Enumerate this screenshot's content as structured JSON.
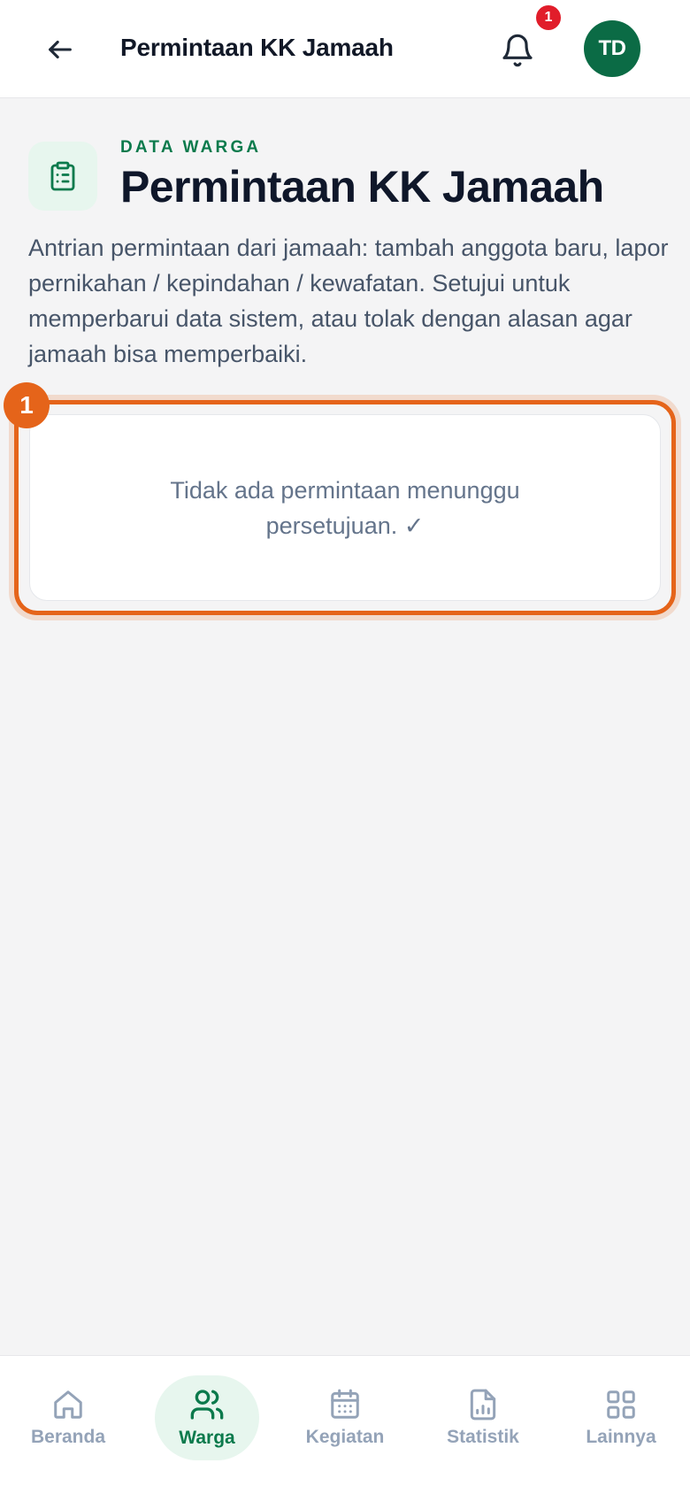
{
  "header": {
    "title": "Permintaan KK Jamaah",
    "notification_count": "1",
    "avatar_initials": "TD"
  },
  "page": {
    "eyebrow": "DATA WARGA",
    "title": "Permintaan KK Jamaah",
    "description": "Antrian permintaan dari jamaah: tambah anggota baru, lapor pernikahan / kepindahan / kewafatan. Setujui untuk memperbarui data sistem, atau tolak dengan alasan agar jamaah bisa memperbaiki."
  },
  "empty_state": {
    "marker": "1",
    "message": "Tidak ada permintaan menunggu persetujuan. ✓"
  },
  "nav": {
    "items": [
      {
        "label": "Beranda",
        "icon": "home-icon"
      },
      {
        "label": "Warga",
        "icon": "users-icon"
      },
      {
        "label": "Kegiatan",
        "icon": "calendar-icon"
      },
      {
        "label": "Statistik",
        "icon": "chart-file-icon"
      },
      {
        "label": "Lainnya",
        "icon": "grid-icon"
      }
    ],
    "active": "Warga"
  },
  "colors": {
    "primary": "#0b6b45",
    "accent": "#0b7a4c",
    "highlight": "#e5641a",
    "badge": "#e11d2a"
  }
}
